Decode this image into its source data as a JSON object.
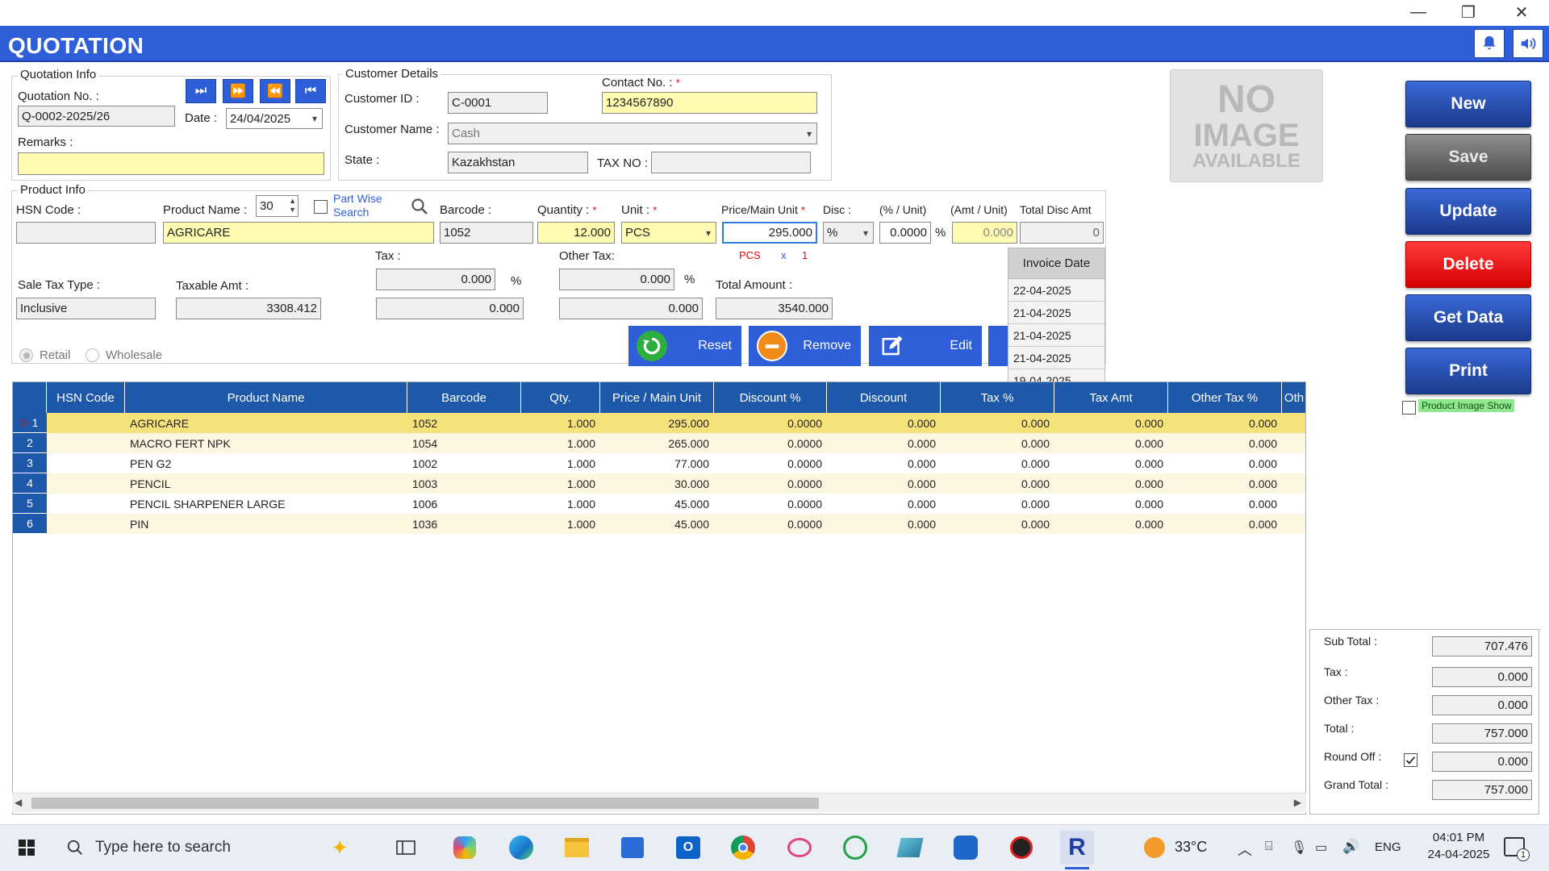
{
  "window": {
    "title": "QUOTATION",
    "minimize": "—",
    "restore": "❐",
    "close": "✕"
  },
  "quotation_info": {
    "title": "Quotation Info",
    "number_label": "Quotation No. :",
    "number": "Q-0002-2025/26",
    "date_label": "Date :",
    "date": "24/04/2025",
    "remarks_label": "Remarks :",
    "remarks": "",
    "nav": [
      "⏭",
      "⏩",
      "⏪",
      "⏮"
    ]
  },
  "customer": {
    "title": "Customer Details",
    "id_label": "Customer ID :",
    "id": "C-0001",
    "contact_label": "Contact No. :",
    "contact": "1234567890",
    "name_label": "Customer Name :",
    "name": "Cash",
    "state_label": "State :",
    "state": "Kazakhstan",
    "tax_label": "TAX NO :",
    "tax_no": ""
  },
  "no_image": {
    "line1": "NO",
    "line2": "IMAGE",
    "line3": "AVAILABLE"
  },
  "product": {
    "title": "Product Info",
    "hsn_label": "HSN Code :",
    "hsn": "",
    "name_label": "Product Name :",
    "name": "AGRICARE",
    "spin": "30",
    "part_wise": "Part Wise Search",
    "barcode_label": "Barcode :",
    "barcode": "1052",
    "qty_label": "Quantity :",
    "qty": "12.000",
    "unit_label": "Unit :",
    "unit": "PCS",
    "price_label": "Price/Main Unit",
    "price": "295.000",
    "disc_label": "Disc :",
    "disc_type": "%",
    "pct_unit_label": "(% / Unit)",
    "pct_unit": "0.0000",
    "pct_sign": "%",
    "amt_unit_label": "(Amt / Unit)",
    "amt_unit": "0.000",
    "total_disc_label": "Total Disc Amt",
    "total_disc": "0",
    "conv_unit": "PCS",
    "conv_x": "x",
    "conv_qty": "1",
    "sale_tax_label": "Sale Tax Type :",
    "sale_tax": "Inclusive",
    "taxable_label": "Taxable Amt :",
    "taxable": "3308.412",
    "tax_label": "Tax :",
    "tax_pct": "0.000",
    "tax_amt": "0.000",
    "other_tax_label": "Other Tax:",
    "other_tax_pct": "0.000",
    "other_tax_amt": "0.000",
    "total_amount_label": "Total Amount :",
    "total_amount": "3540.000",
    "retail": "Retail",
    "wholesale": "Wholesale"
  },
  "actions": {
    "reset": "Reset",
    "remove": "Remove",
    "edit": "Edit"
  },
  "invoice_popup": {
    "header": "Invoice Date",
    "dates": [
      "22-04-2025",
      "21-04-2025",
      "21-04-2025",
      "21-04-2025",
      "19-04-2025"
    ]
  },
  "side_buttons": {
    "new": "New",
    "save": "Save",
    "update": "Update",
    "delete": "Delete",
    "get_data": "Get Data",
    "print": "Print",
    "product_image_show": "Product Image Show"
  },
  "grid": {
    "columns": [
      "HSN Code",
      "Product Name",
      "Barcode",
      "Qty.",
      "Price / Main Unit",
      "Discount %",
      "Discount",
      "Tax %",
      "Tax Amt",
      "Other Tax %",
      "Oth"
    ],
    "rows": [
      {
        "n": "1",
        "hsn": "",
        "name": "AGRICARE",
        "barcode": "1052",
        "qty": "1.000",
        "price": "295.000",
        "disc_pct": "0.0000",
        "disc": "0.000",
        "tax_pct": "0.000",
        "tax_amt": "0.000",
        "other_pct": "0.000"
      },
      {
        "n": "2",
        "hsn": "",
        "name": "MACRO FERT NPK",
        "barcode": "1054",
        "qty": "1.000",
        "price": "265.000",
        "disc_pct": "0.0000",
        "disc": "0.000",
        "tax_pct": "0.000",
        "tax_amt": "0.000",
        "other_pct": "0.000"
      },
      {
        "n": "3",
        "hsn": "",
        "name": "PEN G2",
        "barcode": "1002",
        "qty": "1.000",
        "price": "77.000",
        "disc_pct": "0.0000",
        "disc": "0.000",
        "tax_pct": "0.000",
        "tax_amt": "0.000",
        "other_pct": "0.000"
      },
      {
        "n": "4",
        "hsn": "",
        "name": "PENCIL",
        "barcode": "1003",
        "qty": "1.000",
        "price": "30.000",
        "disc_pct": "0.0000",
        "disc": "0.000",
        "tax_pct": "0.000",
        "tax_amt": "0.000",
        "other_pct": "0.000"
      },
      {
        "n": "5",
        "hsn": "",
        "name": "PENCIL SHARPENER LARGE",
        "barcode": "1006",
        "qty": "1.000",
        "price": "45.000",
        "disc_pct": "0.0000",
        "disc": "0.000",
        "tax_pct": "0.000",
        "tax_amt": "0.000",
        "other_pct": "0.000"
      },
      {
        "n": "6",
        "hsn": "",
        "name": "PIN",
        "barcode": "1036",
        "qty": "1.000",
        "price": "45.000",
        "disc_pct": "0.0000",
        "disc": "0.000",
        "tax_pct": "0.000",
        "tax_amt": "0.000",
        "other_pct": "0.000"
      }
    ]
  },
  "totals": {
    "sub_total_label": "Sub Total :",
    "sub_total": "707.476",
    "tax_label": "Tax :",
    "tax": "0.000",
    "other_tax_label": "Other Tax :",
    "other_tax": "0.000",
    "total_label": "Total :",
    "total": "757.000",
    "round_off_label": "Round Off :",
    "round_off": "0.000",
    "grand_total_label": "Grand Total :",
    "grand_total": "757.000"
  },
  "taskbar": {
    "search_placeholder": "Type here to search",
    "weather": "33°C",
    "lang": "ENG",
    "time": "04:01 PM",
    "date": "24-04-2025",
    "notif_count": "1"
  },
  "colors": {
    "header_blue": "#2f5fd8",
    "grid_blue": "#1e58a8",
    "delete_red": "#ff1f1f",
    "highlight_yellow": "#fffbb0"
  }
}
